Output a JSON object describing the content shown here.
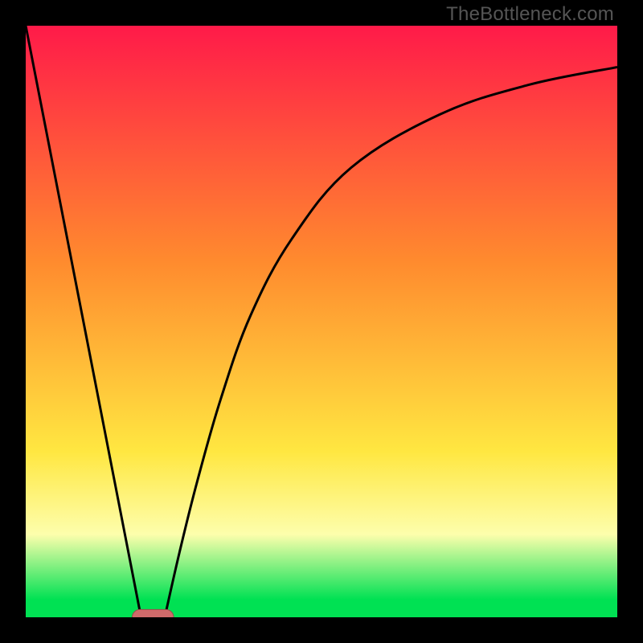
{
  "watermark": "TheBottleneck.com",
  "colors": {
    "frame": "#000000",
    "curve": "#000000",
    "marker_fill": "#cf6a6a",
    "marker_stroke": "#9a4b4b",
    "gradient_top": "#ff1a49",
    "gradient_mid1": "#ff8b2e",
    "gradient_mid2": "#ffe741",
    "gradient_band": "#fdfeac",
    "gradient_bottom": "#00e153"
  },
  "chart_data": {
    "type": "line",
    "title": "",
    "xlabel": "",
    "ylabel": "",
    "xlim": [
      0,
      100
    ],
    "ylim": [
      0,
      100
    ],
    "axes_visible": false,
    "grid": false,
    "background_gradient": {
      "stops": [
        {
          "pos": 0.0,
          "color": "#ff1a49"
        },
        {
          "pos": 0.4,
          "color": "#ff8b2e"
        },
        {
          "pos": 0.72,
          "color": "#ffe741"
        },
        {
          "pos": 0.86,
          "color": "#fdfeac"
        },
        {
          "pos": 0.97,
          "color": "#00e153"
        },
        {
          "pos": 1.0,
          "color": "#00e153"
        }
      ]
    },
    "series": [
      {
        "name": "left-branch",
        "x": [
          0,
          19.5
        ],
        "y": [
          100,
          0
        ],
        "style": "straight"
      },
      {
        "name": "right-branch",
        "x": [
          23.5,
          26,
          29,
          33,
          38,
          45,
          55,
          70,
          85,
          100
        ],
        "y": [
          0,
          11,
          23,
          37,
          51,
          64,
          76,
          85,
          90,
          93
        ],
        "style": "smooth"
      }
    ],
    "marker": {
      "shape": "stadium",
      "center_x": 21.5,
      "center_y": 0,
      "width": 7,
      "height": 2.6
    }
  }
}
